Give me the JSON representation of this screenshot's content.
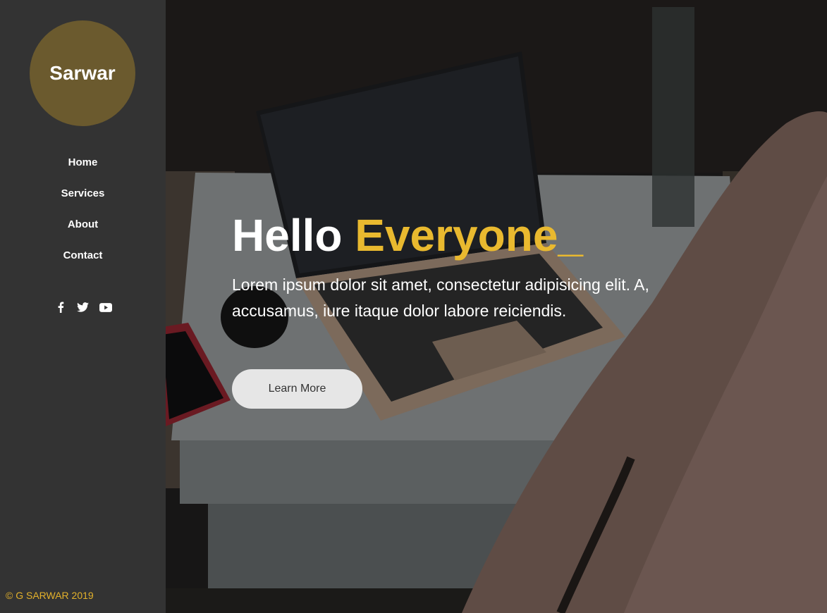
{
  "brand": {
    "name": "Sarwar",
    "logo_color": "#6b5a2e"
  },
  "nav": {
    "items": [
      {
        "label": "Home"
      },
      {
        "label": "Services"
      },
      {
        "label": "About"
      },
      {
        "label": "Contact"
      }
    ]
  },
  "social": {
    "icons": [
      "facebook-icon",
      "twitter-icon",
      "youtube-icon"
    ]
  },
  "footer": {
    "copyright": "© G SARWAR 2019"
  },
  "hero": {
    "title_part1": "Hello ",
    "title_part2": "Everyone_",
    "description": "Lorem ipsum dolor sit amet, consectetur adipisicing elit. A, accusamus, iure itaque dolor labore reiciendis.",
    "button_label": "Learn More",
    "accent_color": "#e9b92f"
  }
}
